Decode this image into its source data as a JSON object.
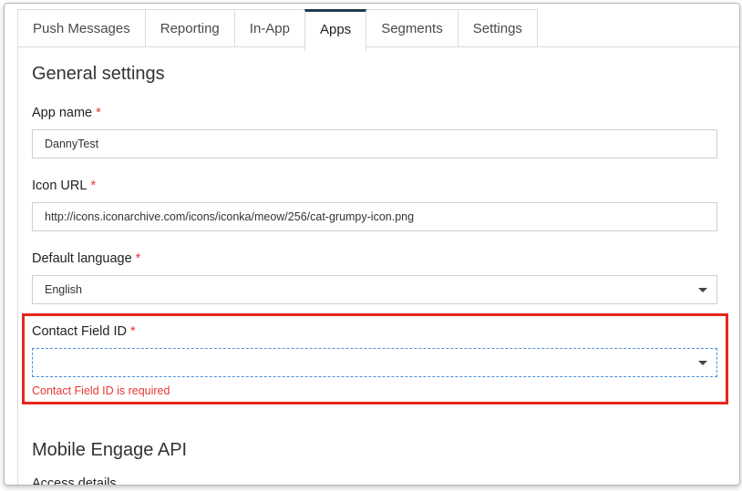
{
  "tabs": [
    {
      "label": "Push Messages",
      "active": false
    },
    {
      "label": "Reporting",
      "active": false
    },
    {
      "label": "In-App",
      "active": false
    },
    {
      "label": "Apps",
      "active": true
    },
    {
      "label": "Segments",
      "active": false
    },
    {
      "label": "Settings",
      "active": false
    }
  ],
  "general": {
    "title": "General settings",
    "required_marker": "*",
    "app_name": {
      "label": "App name",
      "value": "DannyTest"
    },
    "icon_url": {
      "label": "Icon URL",
      "value": "http://icons.iconarchive.com/icons/iconka/meow/256/cat-grumpy-icon.png"
    },
    "default_language": {
      "label": "Default language",
      "value": "English"
    },
    "contact_field_id": {
      "label": "Contact Field ID",
      "value": "",
      "error": "Contact Field ID is required"
    }
  },
  "mobile_engage": {
    "title": "Mobile Engage API",
    "next_label": "Access details"
  },
  "colors": {
    "active_tab": "#1f3a4d",
    "required": "#e53935",
    "annotation_box": "#e8261d",
    "focus_border": "#4a90d9"
  }
}
